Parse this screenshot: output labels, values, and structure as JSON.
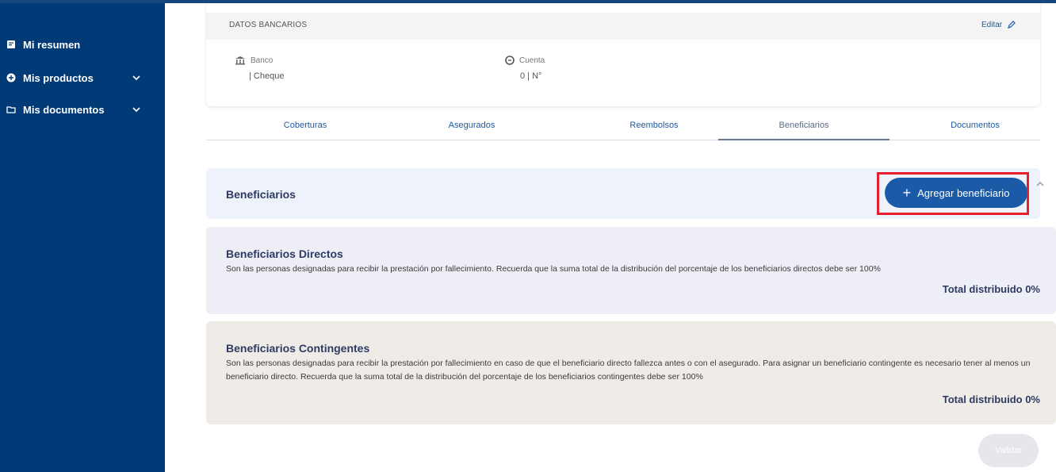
{
  "sidebar": {
    "items": [
      {
        "label": "Mi resumen",
        "icon": "summary-icon"
      },
      {
        "label": "Mis productos",
        "icon": "products-icon",
        "expandable": true
      },
      {
        "label": "Mis documentos",
        "icon": "folder-icon",
        "expandable": true
      }
    ]
  },
  "bank_card": {
    "title": "DATOS BANCARIOS",
    "edit_label": "Editar",
    "bank_label": "Banco",
    "bank_value": "| Cheque",
    "account_label": "Cuenta",
    "account_value": "0 | N°"
  },
  "tabs": [
    {
      "label": "Coberturas"
    },
    {
      "label": "Asegurados"
    },
    {
      "label": "Reembolsos"
    },
    {
      "label": "Beneficiarios",
      "active": true
    },
    {
      "label": "Documentos"
    }
  ],
  "beneficiarios": {
    "title": "Beneficiarios",
    "add_button_label": "Agregar beneficiario"
  },
  "directos": {
    "title": "Beneficiarios Directos",
    "description": "Son las personas designadas para recibir la prestación por fallecimiento. Recuerda que la suma total de la distribución del porcentaje de los beneficiarios directos debe ser 100%",
    "total": "Total distribuido 0%"
  },
  "contingentes": {
    "title": "Beneficiarios Contingentes",
    "description": "Son las personas designadas para recibir la prestación por fallecimiento en caso de que el beneficiario directo fallezca antes o con el asegurado. Para asignar un beneficiario contingente es necesario tener al menos un beneficiario directo. Recuerda que la suma total de la distribución del porcentaje de los beneficiarios contingentes debe ser 100%",
    "total": "Total distribuido 0%"
  },
  "validar_label": "Validar",
  "colors": {
    "sidebar": "#003b78",
    "primary": "#1a5aa6",
    "highlight": "#e5202c"
  }
}
